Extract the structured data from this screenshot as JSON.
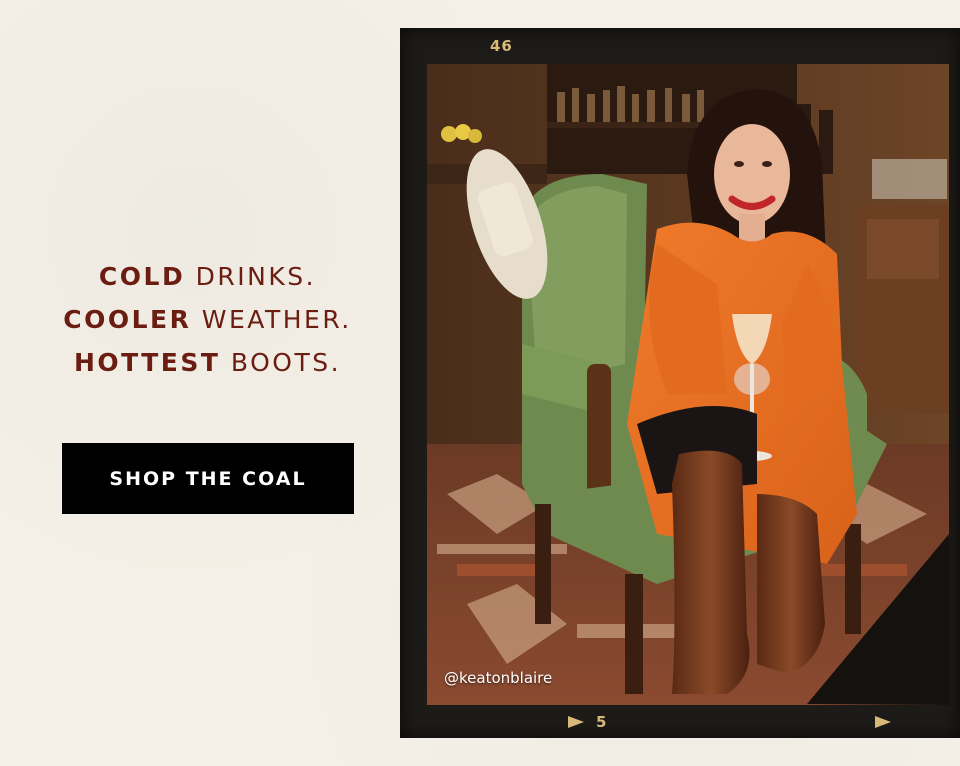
{
  "headline": {
    "line1_bold": "COLD",
    "line1_light": " DRINKS.",
    "line2_bold": "COOLER",
    "line2_light": " WEATHER.",
    "line3_bold": "HOTTEST",
    "line3_light": " BOOTS."
  },
  "cta": {
    "label": "SHOP THE COAL"
  },
  "film": {
    "frame_top_number": "46",
    "frame_bottom_number": "5"
  },
  "photo": {
    "handle": "@keatonblaire",
    "description_icon": "photo-woman-in-chair"
  },
  "colors": {
    "headline": "#6b1d12",
    "button_bg": "#000000",
    "button_text": "#ffffff",
    "film_accent": "#d9b978"
  }
}
